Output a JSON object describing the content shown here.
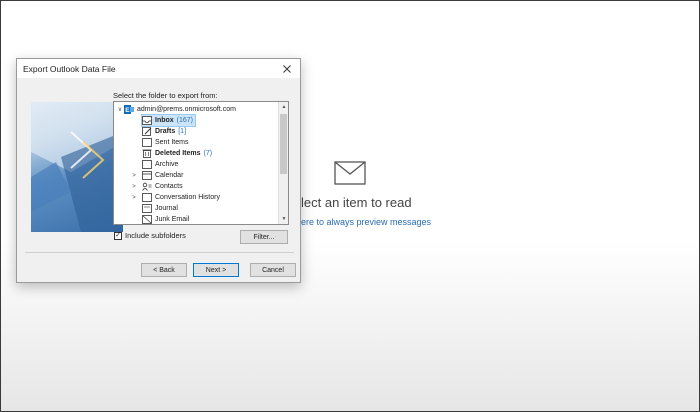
{
  "dialog": {
    "title": "Export Outlook Data File",
    "select_label": "Select the folder to export from:",
    "include_subfolders_label": "Include subfolders",
    "include_subfolders_checked": true,
    "filter_label": "Filter...",
    "back_label": "< Back",
    "next_label": "Next >",
    "cancel_label": "Cancel"
  },
  "tree": {
    "account": "admin@prems.onmicrosoft.com",
    "items": [
      {
        "label": "Inbox",
        "count": "(167)",
        "bold": true,
        "selected": true,
        "icon": "inbox-icon"
      },
      {
        "label": "Drafts",
        "count": "[1]",
        "bold": true,
        "icon": "drafts-icon"
      },
      {
        "label": "Sent Items",
        "count": "",
        "bold": false,
        "icon": "sent-icon"
      },
      {
        "label": "Deleted Items",
        "count": "(7)",
        "bold": true,
        "icon": "trash-icon"
      },
      {
        "label": "Archive",
        "count": "",
        "bold": false,
        "icon": "archive-icon"
      },
      {
        "label": "Calendar",
        "count": "",
        "bold": false,
        "icon": "calendar-icon",
        "expandable": true
      },
      {
        "label": "Contacts",
        "count": "",
        "bold": false,
        "icon": "contacts-icon",
        "expandable": true
      },
      {
        "label": "Conversation History",
        "count": "",
        "bold": false,
        "icon": "folder-icon",
        "expandable": true
      },
      {
        "label": "Journal",
        "count": "",
        "bold": false,
        "icon": "journal-icon"
      },
      {
        "label": "Junk Email",
        "count": "",
        "bold": false,
        "icon": "junk-icon"
      }
    ]
  },
  "reading_pane": {
    "message": "lect an item to read",
    "link": "ere to always preview messages"
  },
  "colors": {
    "accent": "#0078d7",
    "count_blue": "#2a6ab8",
    "outlook_blue": "#0f6cbd"
  }
}
